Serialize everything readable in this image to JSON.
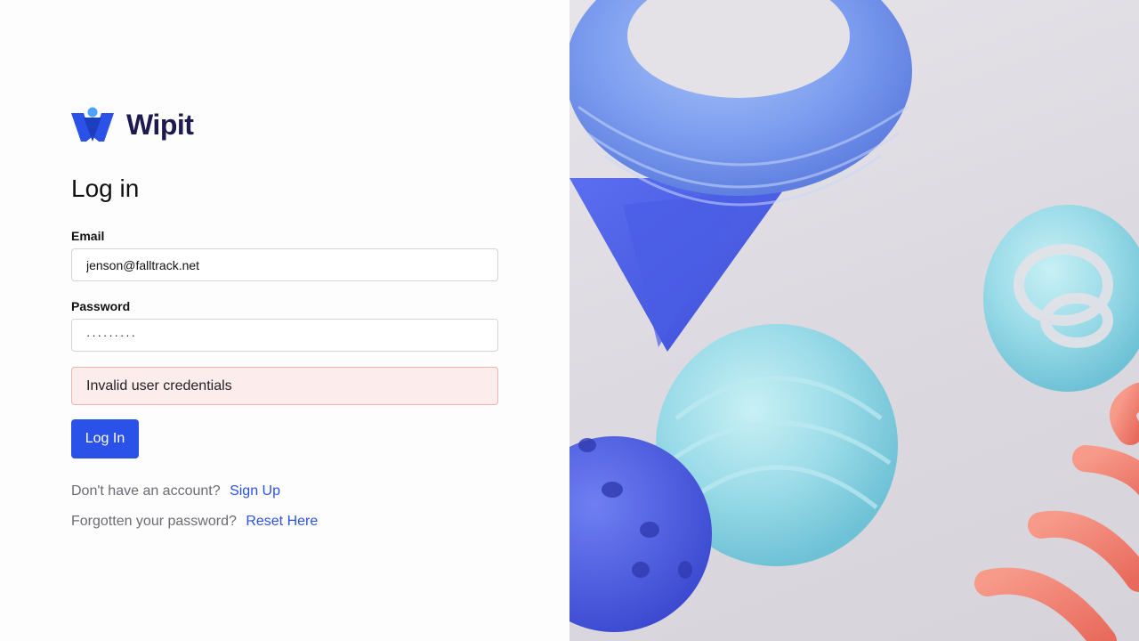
{
  "brand": {
    "name": "Wipit",
    "colors": {
      "primary": "#2b52e8",
      "logo_dark": "#1c1a4e",
      "logo_light": "#4da3ff"
    }
  },
  "page": {
    "title": "Log in"
  },
  "form": {
    "email": {
      "label": "Email",
      "value": "jenson@falltrack.net"
    },
    "password": {
      "label": "Password",
      "value": "·········"
    },
    "error": "Invalid user credentials",
    "submit_label": "Log In"
  },
  "footer": {
    "signup_prompt": "Don't have an account?",
    "signup_link": "Sign Up",
    "reset_prompt": "Forgotten your password?",
    "reset_link": "Reset Here"
  },
  "hero": {
    "icon": "abstract-3d-shapes-image"
  }
}
